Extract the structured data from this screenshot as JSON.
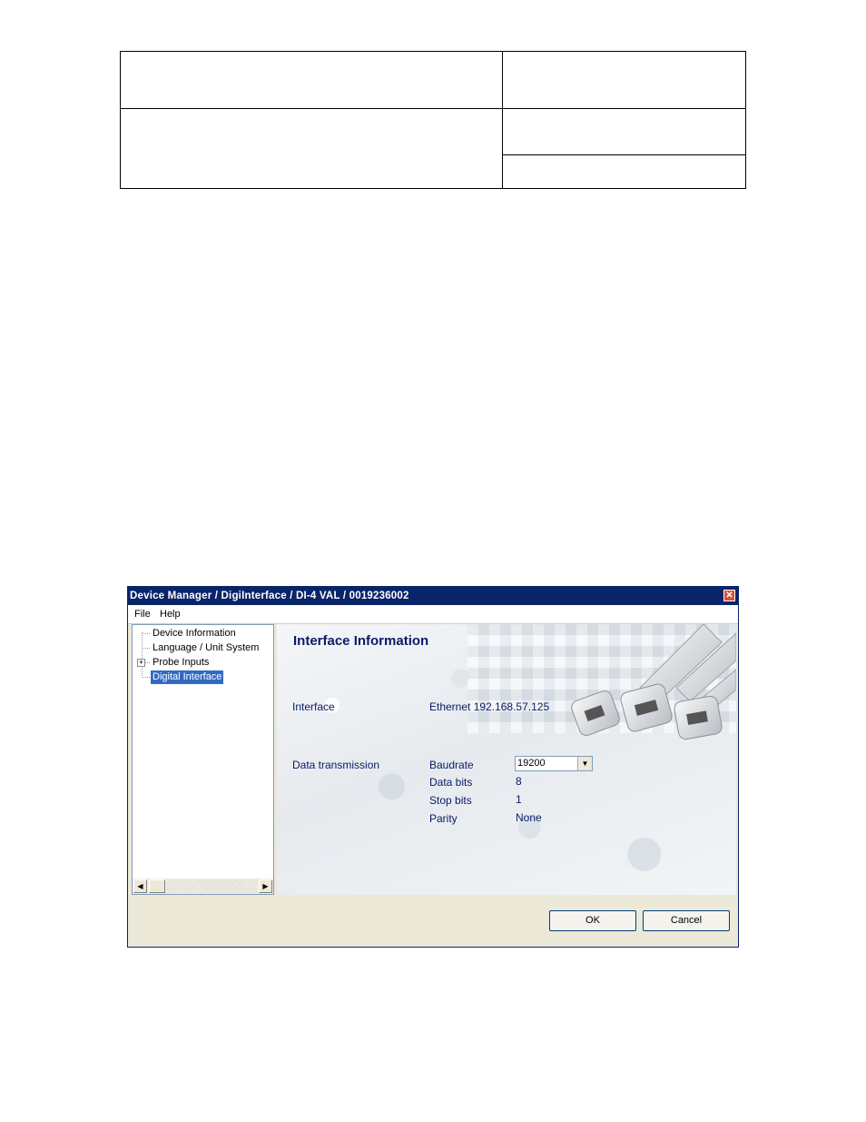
{
  "window": {
    "title": "Device Manager / DigiInterface / DI-4 VAL / 0019236002",
    "close_glyph": "✕"
  },
  "menu": {
    "file": "File",
    "help": "Help"
  },
  "tree": {
    "items": [
      {
        "label": "Device Information"
      },
      {
        "label": "Language / Unit System"
      },
      {
        "label": "Probe Inputs",
        "expander": "+"
      },
      {
        "label": "Digital Interface",
        "selected": true
      }
    ]
  },
  "panel": {
    "title": "Interface Information",
    "interface_label": "Interface",
    "interface_value": "Ethernet 192.168.57.125",
    "data_transmission_label": "Data transmission",
    "baudrate_label": "Baudrate",
    "baudrate_value": "19200",
    "data_bits_label": "Data bits",
    "data_bits_value": "8",
    "stop_bits_label": "Stop bits",
    "stop_bits_value": "1",
    "parity_label": "Parity",
    "parity_value": "None"
  },
  "buttons": {
    "ok": "OK",
    "cancel": "Cancel"
  },
  "icons": {
    "close": "close-icon",
    "dropdown": "chevron-down-icon",
    "scroll_left": "arrow-left-icon",
    "scroll_right": "arrow-right-icon"
  }
}
